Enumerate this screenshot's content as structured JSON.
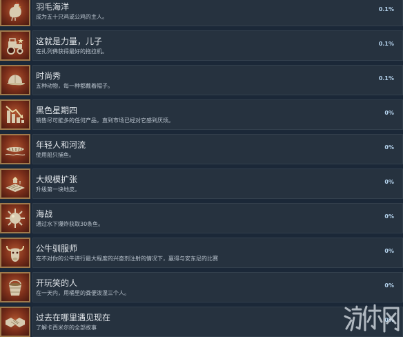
{
  "achievements": [
    {
      "title": "羽毛海洋",
      "desc": "成为五十只鸡或公鸡的主人。",
      "percent": "0.1%",
      "icon": "chicken-icon"
    },
    {
      "title": "这就是力量，儿子",
      "desc": "在扎列佛获得最好的拖拉机。",
      "percent": "0.1%",
      "icon": "tractor-icon"
    },
    {
      "title": "时尚秀",
      "desc": "五种动物，每一种都戴着帽子。",
      "percent": "0.1%",
      "icon": "cap-icon"
    },
    {
      "title": "黑色星期四",
      "desc": "销售尽可能多的任何产品，直到市场已经对它感到厌烦。",
      "percent": "0%",
      "icon": "falling-chart-icon"
    },
    {
      "title": "年轻人和河流",
      "desc": "使用船只捕鱼。",
      "percent": "0%",
      "icon": "boat-icon"
    },
    {
      "title": "大规模扩张",
      "desc": "升级第一块地皮。",
      "percent": "0%",
      "icon": "farmland-icon"
    },
    {
      "title": "海战",
      "desc": "通过水下爆炸获取30条鱼。",
      "percent": "0%",
      "icon": "sea-mine-icon"
    },
    {
      "title": "公牛驯服师",
      "desc": "在不对你的公牛进行最大程度的兴奋剂注射的情况下，赢得与安东尼的比赛",
      "percent": "0%",
      "icon": "bull-icon"
    },
    {
      "title": "开玩笑的人",
      "desc": "在一天内，用桶里的粪便泼湿三个人。",
      "percent": "0%",
      "icon": "bucket-icon"
    },
    {
      "title": "过去在哪里遇见现在",
      "desc": "了解卡西米尔的全部故事",
      "percent": "0%",
      "icon": "handshake-icon"
    }
  ],
  "watermark": {
    "text": "游侠网"
  },
  "colors": {
    "background": "#1b2838",
    "panel": "#26323f",
    "title": "#e4e8ec",
    "description": "#b8c2cc",
    "percent": "#b6d4ee",
    "icon_border": "#a07a4c",
    "icon_bg": "#7a2e1a"
  }
}
